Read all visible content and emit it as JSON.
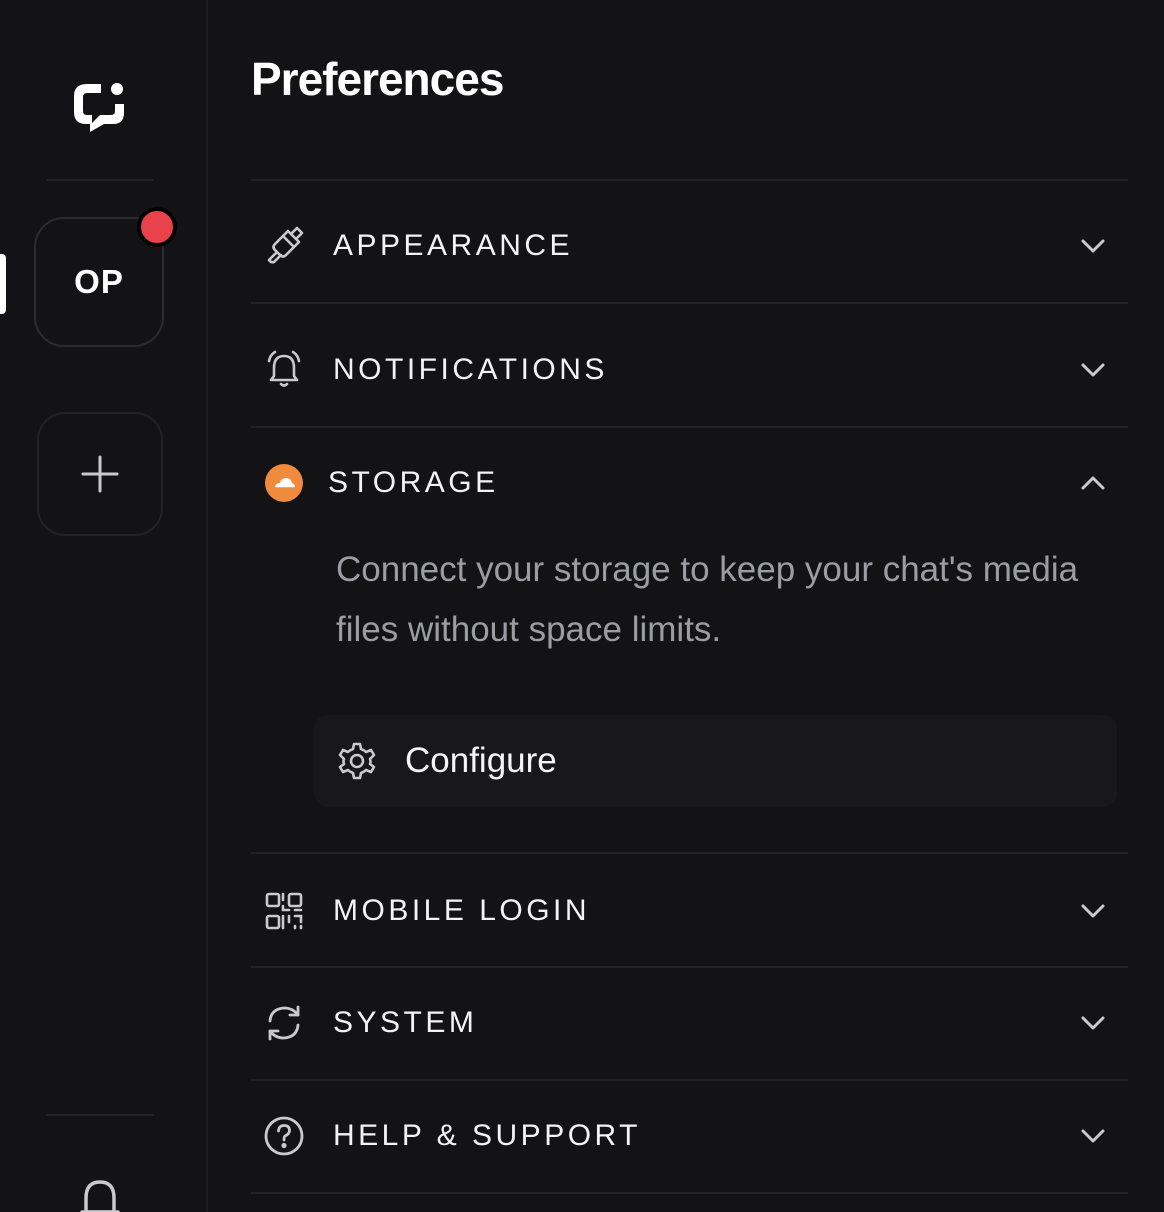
{
  "sidebar": {
    "logo_icon": "chat-bubble-logo-icon",
    "workspace": {
      "initials": "OP",
      "has_notification": true
    },
    "add_icon": "plus-icon",
    "bottom_icon": "bell-icon"
  },
  "page": {
    "title": "Preferences"
  },
  "sections": {
    "appearance": {
      "label": "APPEARANCE",
      "icon": "paintbrush-icon",
      "expanded": false
    },
    "notifications": {
      "label": "NOTIFICATIONS",
      "icon": "bell-ringing-icon",
      "expanded": false
    },
    "storage": {
      "label": "STORAGE",
      "icon": "cloud-storage-icon",
      "expanded": true,
      "description": "Connect your storage to keep your chat's media files without space limits.",
      "configure_label": "Configure"
    },
    "mobile_login": {
      "label": "MOBILE LOGIN",
      "icon": "qr-code-icon",
      "expanded": false
    },
    "system": {
      "label": "SYSTEM",
      "icon": "refresh-icon",
      "expanded": false
    },
    "help_support": {
      "label": "HELP & SUPPORT",
      "icon": "question-circle-icon",
      "expanded": false
    }
  },
  "colors": {
    "background": "#131315",
    "accent_orange": "#f08a3c",
    "badge_red": "#e8424a",
    "muted_text": "#9c9ca3"
  }
}
